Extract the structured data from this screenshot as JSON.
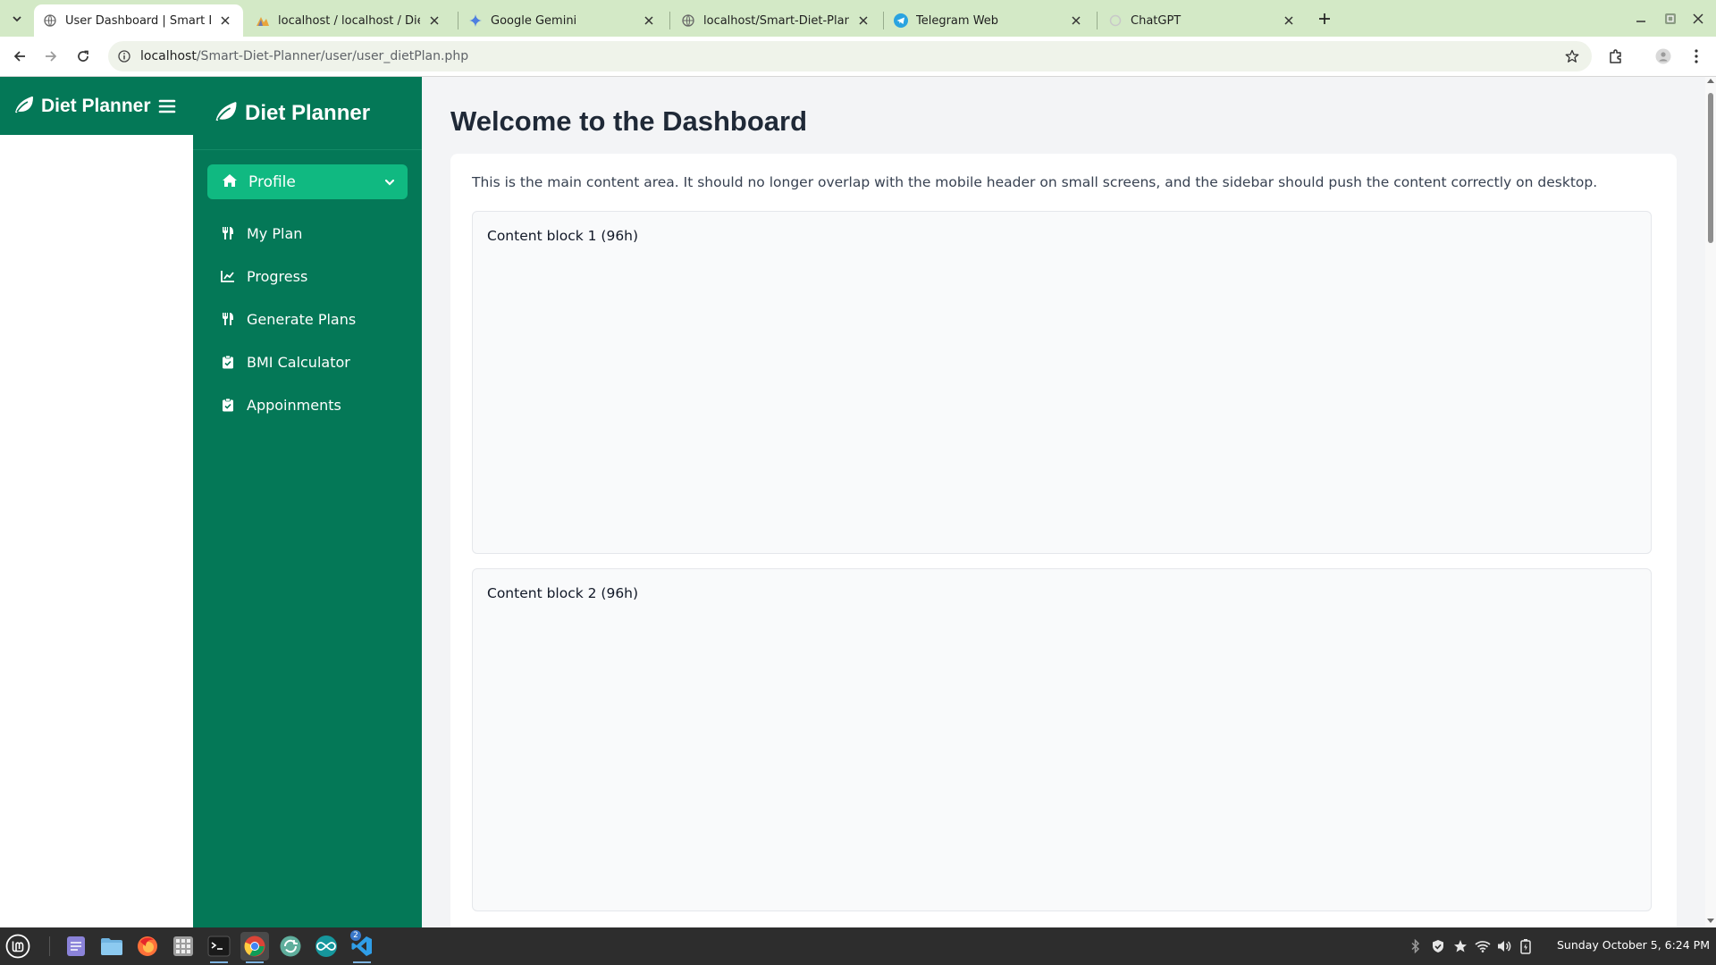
{
  "browser": {
    "tabs": [
      {
        "title": "User Dashboard | Smart Diet",
        "active": true,
        "icon": "globe-icon"
      },
      {
        "title": "localhost / localhost / DietPl",
        "active": false,
        "icon": "phpmyadmin-icon"
      },
      {
        "title": "Google Gemini",
        "active": false,
        "icon": "gemini-icon"
      },
      {
        "title": "localhost/Smart-Diet-Planne",
        "active": false,
        "icon": "globe-icon"
      },
      {
        "title": "Telegram Web",
        "active": false,
        "icon": "telegram-icon"
      },
      {
        "title": "ChatGPT",
        "active": false,
        "icon": "chatgpt-icon"
      }
    ],
    "url_host": "localhost",
    "url_path": "/Smart-Diet-Planner/user/user_dietPlan.php"
  },
  "mobile_header": {
    "brand": "Diet Planner"
  },
  "sidebar": {
    "brand": "Diet Planner",
    "profile": {
      "label": "Profile"
    },
    "items": [
      {
        "label": "My Plan",
        "icon": "utensils-icon"
      },
      {
        "label": "Progress",
        "icon": "chart-line-icon"
      },
      {
        "label": "Generate Plans",
        "icon": "utensils-icon"
      },
      {
        "label": "BMI Calculator",
        "icon": "clipboard-check-icon"
      },
      {
        "label": "Appoinments",
        "icon": "clipboard-check-icon"
      }
    ]
  },
  "main": {
    "title": "Welcome to the Dashboard",
    "intro": "This is the main content area. It should no longer overlap with the mobile header on small screens, and the sidebar should push the content correctly on desktop.",
    "blocks": [
      {
        "label": "Content block 1 (96h)"
      },
      {
        "label": "Content block 2 (96h)"
      }
    ]
  },
  "taskbar": {
    "workspace_badge": "2",
    "clock": "Sunday October  5,  6:24 PM"
  },
  "colors": {
    "sidebar": "#047857",
    "profile_active": "#10b981",
    "tabbar": "#d3e9c6",
    "page_bg": "#f3f4f6"
  }
}
